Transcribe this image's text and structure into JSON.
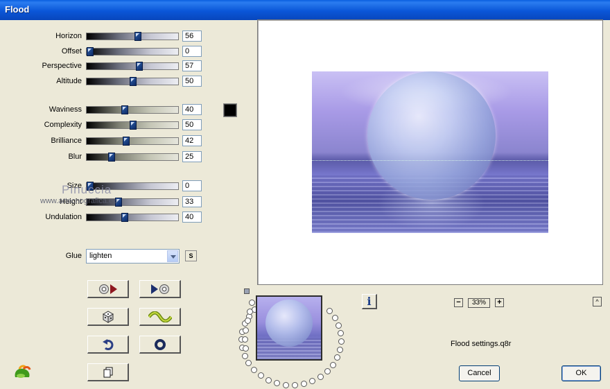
{
  "window": {
    "title": "Flood"
  },
  "sliders": [
    {
      "label": "Horizon",
      "value": "56",
      "fraction": 0.56,
      "style": "light"
    },
    {
      "label": "Offset",
      "value": "0",
      "fraction": 0.0,
      "style": "light"
    },
    {
      "label": "Perspective",
      "value": "57",
      "fraction": 0.57,
      "style": "light"
    },
    {
      "label": "Altitude",
      "value": "50",
      "fraction": 0.5,
      "style": "light"
    },
    {
      "label": "Waviness",
      "value": "40",
      "fraction": 0.4,
      "style": "beige"
    },
    {
      "label": "Complexity",
      "value": "50",
      "fraction": 0.5,
      "style": "beige"
    },
    {
      "label": "Brilliance",
      "value": "42",
      "fraction": 0.42,
      "style": "beige"
    },
    {
      "label": "Blur",
      "value": "25",
      "fraction": 0.25,
      "style": "beige"
    },
    {
      "label": "Size",
      "value": "0",
      "fraction": 0.0,
      "style": "light"
    },
    {
      "label": "Height",
      "value": "33",
      "fraction": 0.33,
      "style": "light"
    },
    {
      "label": "Undulation",
      "value": "40",
      "fraction": 0.4,
      "style": "light"
    }
  ],
  "color_swatch": "#000000",
  "watermark": {
    "name": "Pinuccia",
    "url": "www.artecnografica.eu"
  },
  "glue": {
    "label": "Glue",
    "value": "lighten",
    "s_label": "S"
  },
  "zoom": {
    "value": "33%",
    "minus": "−",
    "plus": "+"
  },
  "info_icon": "i",
  "collapse_icon": "^",
  "settings_file": "Flood settings.q8r",
  "buttons": {
    "cancel": "Cancel",
    "ok": "OK"
  }
}
